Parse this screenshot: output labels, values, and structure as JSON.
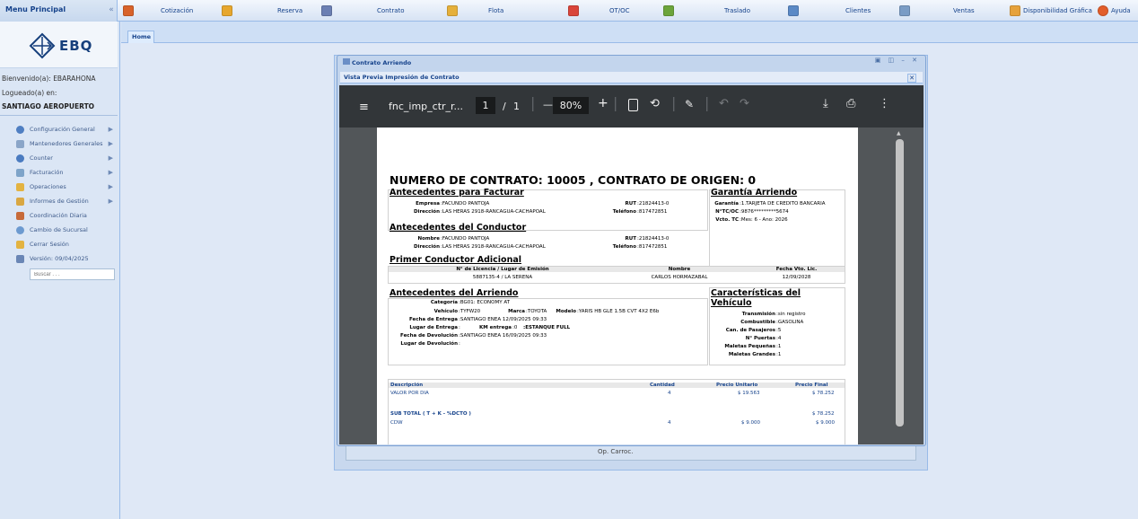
{
  "top": {
    "menu_header": "Menu Principal",
    "collapse_icon": "«",
    "items": [
      {
        "label": "Cotización",
        "icon": "cotizacion-icon",
        "color": "#d8622a"
      },
      {
        "label": "Reserva",
        "icon": "reserva-icon",
        "color": "#e7a72e"
      },
      {
        "label": "Contrato",
        "icon": "contrato-icon",
        "color": "#6b7fb3"
      },
      {
        "label": "Flota",
        "icon": "flota-icon",
        "color": "#e5b03b"
      },
      {
        "label": "OT/OC",
        "icon": "otoc-icon",
        "color": "#d9453a"
      },
      {
        "label": "Traslado",
        "icon": "traslado-icon",
        "color": "#6ba43b"
      },
      {
        "label": "Clientes",
        "icon": "clientes-icon",
        "color": "#5a89c6"
      },
      {
        "label": "Ventas",
        "icon": "ventas-icon",
        "color": "#7a9cc5"
      },
      {
        "label": "Disponibilidad Gráfica",
        "icon": "disponibilidad-icon",
        "color": "#e6a23b"
      },
      {
        "label": "Ayuda",
        "icon": "ayuda-icon",
        "color": "#e25d2a"
      }
    ]
  },
  "sidebar": {
    "logo_text": "EBQ",
    "welcome": "Bienvenido(a): EBARAHONA",
    "logged": "Logueado(a) en:",
    "branch": "SANTIAGO AEROPUERTO",
    "items": [
      {
        "label": "Configuración General",
        "arrow": true,
        "color": "#4f7fc2"
      },
      {
        "label": "Mantenedores Generales",
        "arrow": true,
        "color": "#8aa5c8"
      },
      {
        "label": "Counter",
        "arrow": true,
        "color": "#4a7bc0"
      },
      {
        "label": "Facturación",
        "arrow": true,
        "color": "#7ea4c9"
      },
      {
        "label": "Operaciones",
        "arrow": true,
        "color": "#e3b341"
      },
      {
        "label": "Informes de Gestión",
        "arrow": true,
        "color": "#d9a742"
      },
      {
        "label": "Coordinación Diaria",
        "arrow": false,
        "color": "#c76a3a"
      },
      {
        "label": "Cambio de Sucursal",
        "arrow": false,
        "color": "#6c9ad0"
      },
      {
        "label": "Cerrar Sesión",
        "arrow": false,
        "color": "#e3b341"
      },
      {
        "label": "Versión: 09/04/2025",
        "arrow": false,
        "color": "#6a86b5"
      }
    ],
    "search_placeholder": "Buscar . . ."
  },
  "tabs": {
    "home": "Home"
  },
  "background_form": {
    "label": "Op. Carroc."
  },
  "window": {
    "title": "Contrato Arriendo",
    "controls": "▣ ◫ – ✕",
    "subtitle": "Vista Previa Impresión de Contrato",
    "close": "✕"
  },
  "viewer": {
    "filename": "fnc_imp_ctr_r...",
    "page_current": "1",
    "page_sep": "/",
    "page_total": "1",
    "zoom_minus": "—",
    "zoom": "80%",
    "zoom_plus": "+"
  },
  "doc": {
    "title": "NUMERO DE CONTRATO: 10005 , CONTRATO DE ORIGEN: 0",
    "facturar": {
      "heading": "Antecedentes para Facturar",
      "empresa_label": "Empresa",
      "empresa": ":FACUNDO PANTOJA",
      "rut_label": "RUT",
      "rut": ":21824413-0",
      "direccion_label": "Dirección",
      "direccion": ":LAS HERAS 2918-RANCAGUA-CACHAPOAL",
      "telefono_label": "Teléfono",
      "telefono": ":817472851"
    },
    "garantia": {
      "heading": "Garantía Arriendo",
      "garantia_label": "Garantía",
      "garantia": ":1.TARJETA DE CREDITO BANCARIA",
      "ntc_label": "N°TC/OC",
      "ntc": ":9876*********5674",
      "vto_label": "Vcto. TC",
      "vto": ":Mes: 6 - Ano: 2026"
    },
    "conductor": {
      "heading": "Antecedentes del Conductor",
      "nombre_label": "Nombre",
      "nombre": ":FACUNDO PANTOJA",
      "rut_label": "RUT",
      "rut": ":21824413-0",
      "direccion_label": "Dirección",
      "direccion": ":LAS HERAS 2918-RANCAGUA-CACHAPOAL",
      "telefono_label": "Teléfono",
      "telefono": ":817472851"
    },
    "adicional": {
      "heading": "Primer Conductor Adicional",
      "col1": "N° de Licencia / Lugar de Emisión",
      "col2": "Nombre",
      "col3": "Fecha Vto. Lic.",
      "v1": "5887135-4 / LA SERENA",
      "v2": "CARLOS HORMAZABAL",
      "v3": "12/09/2028"
    },
    "arriendo": {
      "heading": "Antecedentes del Arriendo",
      "categoria_label": "Categoría",
      "categoria": ":BG01: ECONOMY AT",
      "vehiculo_label": "Vehículo",
      "vehiculo": ":TYFW20",
      "marca_label": "Marca",
      "marca": ":TOYOTA",
      "modelo_label": "Modelo",
      "modelo": ":YARIS HB GLE 1.5B CVT 4X2 E6b",
      "fentrega_label": "Fecha de Entrega",
      "fentrega": ":SANTIAGO ENEA 12/09/2025 09:33",
      "lentrega_label": "Lugar de Entrega",
      "lentrega": ":",
      "km_label": "KM entrega",
      "km": ":0",
      "estanque": ":ESTANQUE FULL",
      "fdev_label": "Fecha de Devolución",
      "fdev": ":SANTIAGO ENEA 16/09/2025 09:33",
      "ldev_label": "Lugar de Devolución",
      "ldev": ":"
    },
    "caracteristicas": {
      "heading1": "Características del",
      "heading2": "Vehículo",
      "transmision_label": "Transmisión",
      "transmision": ":sin registro",
      "combustible_label": "Combustible",
      "combustible": ":GASOLINA",
      "pasajeros_label": "Can. de Pasajeros",
      "pasajeros": ":5",
      "puertas_label": "N° Puertas",
      "puertas": ":4",
      "peq_label": "Maletas Pequeñas",
      "peq": ":1",
      "gra_label": "Maletas Grandes",
      "gra": ":1"
    },
    "table": {
      "headers": [
        "Descripción",
        "Cantidad",
        "Precio Unitario",
        "Precio Final"
      ],
      "rows": [
        {
          "d": "VALOR POR DIA",
          "q": "4",
          "u": "$ 19.563",
          "f": "$ 78.252"
        },
        {
          "d": "SUB TOTAL ( T + K - %DCTO )",
          "q": "",
          "u": "",
          "f": "$ 78.252"
        },
        {
          "d": "CDW",
          "q": "4",
          "u": "$ 9.000",
          "f": "$ 9.000"
        }
      ]
    }
  }
}
